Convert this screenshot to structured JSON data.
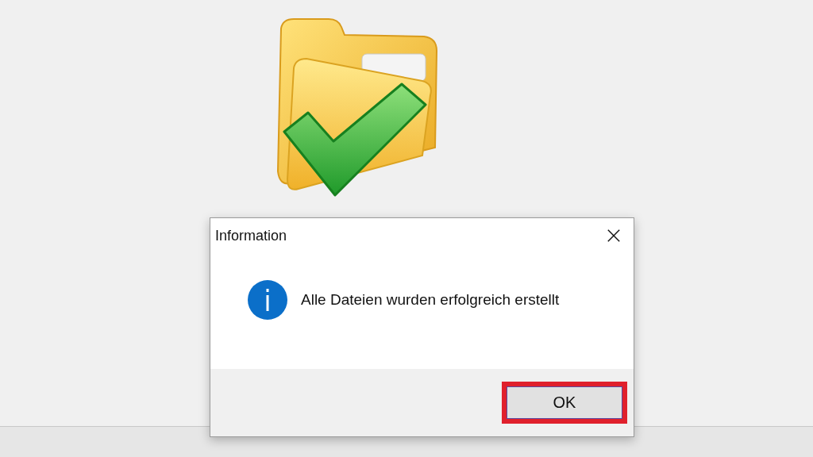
{
  "dialog": {
    "title": "Information",
    "message": "Alle Dateien wurden erfolgreich erstellt",
    "buttons": [
      {
        "label": "OK",
        "highlighted": true
      }
    ]
  }
}
